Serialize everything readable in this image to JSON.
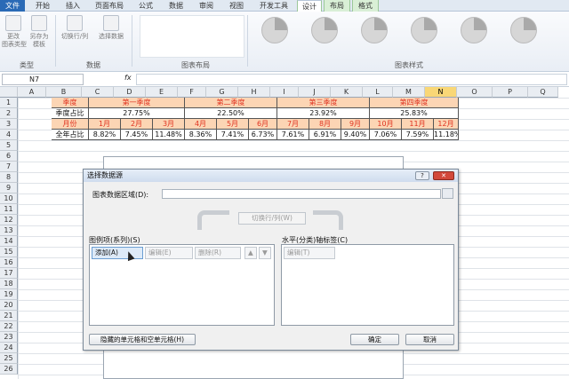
{
  "ribbon_tabs": [
    "文件",
    "开始",
    "插入",
    "页面布局",
    "公式",
    "数据",
    "审阅",
    "视图",
    "开发工具",
    "设计",
    "布局",
    "格式"
  ],
  "ribbon": {
    "buttons": [
      "更改\n图表类型",
      "另存为\n模板",
      "切换行/列",
      "选择数据"
    ],
    "groups": [
      "类型",
      "数据",
      "图表布局",
      "图表样式"
    ]
  },
  "formula_bar": {
    "name_box": "N7",
    "fx": "fx"
  },
  "columns": [
    "A",
    "B",
    "C",
    "D",
    "E",
    "F",
    "G",
    "H",
    "I",
    "J",
    "K",
    "L",
    "M",
    "N",
    "O",
    "P",
    "Q"
  ],
  "rows": [
    "1",
    "2",
    "3",
    "4",
    "5",
    "6",
    "7",
    "8",
    "9",
    "10",
    "11",
    "12",
    "13",
    "14",
    "15",
    "16",
    "17",
    "18",
    "19",
    "20",
    "21",
    "22",
    "23",
    "24",
    "25",
    "26"
  ],
  "table": {
    "r1_label": "季度",
    "quarters": [
      "第一季度",
      "第二季度",
      "第三季度",
      "第四季度"
    ],
    "r2_label": "季度占比",
    "quarter_pcts": [
      "27.75%",
      "22.50%",
      "23.92%",
      "25.83%"
    ],
    "r3_label": "月份",
    "months": [
      "1月",
      "2月",
      "3月",
      "4月",
      "5月",
      "6月",
      "7月",
      "8月",
      "9月",
      "10月",
      "11月",
      "12月"
    ],
    "r4_label": "全年占比",
    "month_pcts": [
      "8.82%",
      "7.45%",
      "11.48%",
      "8.36%",
      "7.41%",
      "6.73%",
      "7.61%",
      "6.91%",
      "9.40%",
      "7.06%",
      "7.59%",
      "11.18%"
    ]
  },
  "dialog": {
    "title": "选择数据源",
    "help": "?",
    "close": "✕",
    "range_label": "图表数据区域(D):",
    "switch_label": "切换行/列(W)",
    "legend_label": "图例项(系列)(S)",
    "add": "添加(A)",
    "edit": "编辑(E)",
    "delete": "删除(R)",
    "up": "▲",
    "down": "▼",
    "axis_label": "水平(分类)轴标签(C)",
    "axis_edit": "编辑(T)",
    "hidden_cells": "隐藏的单元格和空单元格(H)",
    "ok": "确定",
    "cancel": "取消"
  }
}
